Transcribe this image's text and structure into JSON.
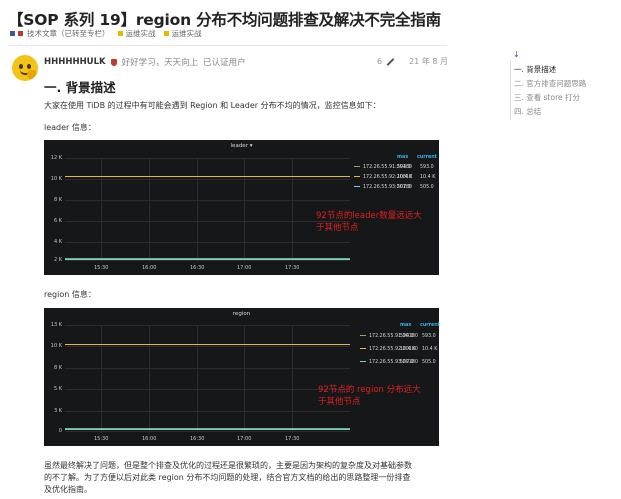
{
  "article": {
    "title": "【SOP 系列 19】region 分布不均问题排查及解决不完全指南",
    "categories": [
      {
        "label": "技术文章（已转至专栏）",
        "colors": [
          "#3b5998",
          "#c0392b"
        ]
      },
      {
        "label": "运维实战",
        "colors": [
          "#e6b800"
        ]
      },
      {
        "label": "运维实战",
        "colors": [
          "#e6b800"
        ]
      }
    ]
  },
  "post": {
    "author": "HHHHHHULK",
    "motto": "好好学习，天天向上",
    "certified": "已认证用户",
    "edit_count": "6",
    "date": "21 年 8 月",
    "heading": "一. 背景描述",
    "intro": "大家在使用 TiDB 的过程中有可能会遇到 Region 和 Leader 分布不均的情况，监控信息如下：",
    "leader_label": "leader 信息：",
    "region_label": "region 信息：",
    "summary_line1": "虽然最终解决了问题，但是整个排查及优化的过程还是很繁琐的，主要是因为架构的复杂度及对基础参数",
    "summary_line2": "的不了解。为了方便以后对此类 region 分布不均问题的处理，结合官方文档的给出的思路整理一份排查",
    "summary_line3": "及优化指南。"
  },
  "charts": {
    "leader": {
      "title": "leader ▾",
      "y_ticks": [
        "12 K",
        "10 K",
        "8 K",
        "6 K",
        "4 K",
        "2 K",
        "0"
      ],
      "x_ticks": [
        "15:30",
        "16:00",
        "16:30",
        "17:00",
        "17:30"
      ],
      "legend_headers": [
        "max",
        "current"
      ],
      "legend": [
        {
          "name": "172.26.55.91:20180",
          "max": "594.0",
          "current": "593.0",
          "color": "#7eb26d"
        },
        {
          "name": "172.26.55.92:20810",
          "max": "10.4 K",
          "current": "10.4 K",
          "color": "#eab839"
        },
        {
          "name": "172.26.55.93:20180",
          "max": "507.0",
          "current": "505.0",
          "color": "#6ed0e0"
        }
      ],
      "annotation_line1": "92节点的leader数量远远大",
      "annotation_line2": "于其他节点"
    },
    "region": {
      "title": "region",
      "y_ticks": [
        "13 K",
        "10 K",
        "8 K",
        "5 K",
        "3 K",
        "0"
      ],
      "x_ticks": [
        "15:30",
        "16:00",
        "16:30",
        "17:00",
        "17:30"
      ],
      "legend_headers": [
        "max",
        "current"
      ],
      "legend": [
        {
          "name": "172.26.55.91:20180",
          "max": "594.0",
          "current": "593.0",
          "color": "#7eb26d"
        },
        {
          "name": "172.26.55.92:20180",
          "max": "10.4 K",
          "current": "10.4 K",
          "color": "#eab839"
        },
        {
          "name": "172.26.55.93:20180",
          "max": "507.0",
          "current": "505.0",
          "color": "#6ed0e0"
        }
      ],
      "annotation_line1": "92节点的 region 分布远大",
      "annotation_line2": "于其他节点"
    }
  },
  "toc": {
    "items": [
      "一. 背景描述",
      "二. 官方排查问题思路",
      "三. 查看 store 打分",
      "四. 总结"
    ]
  }
}
